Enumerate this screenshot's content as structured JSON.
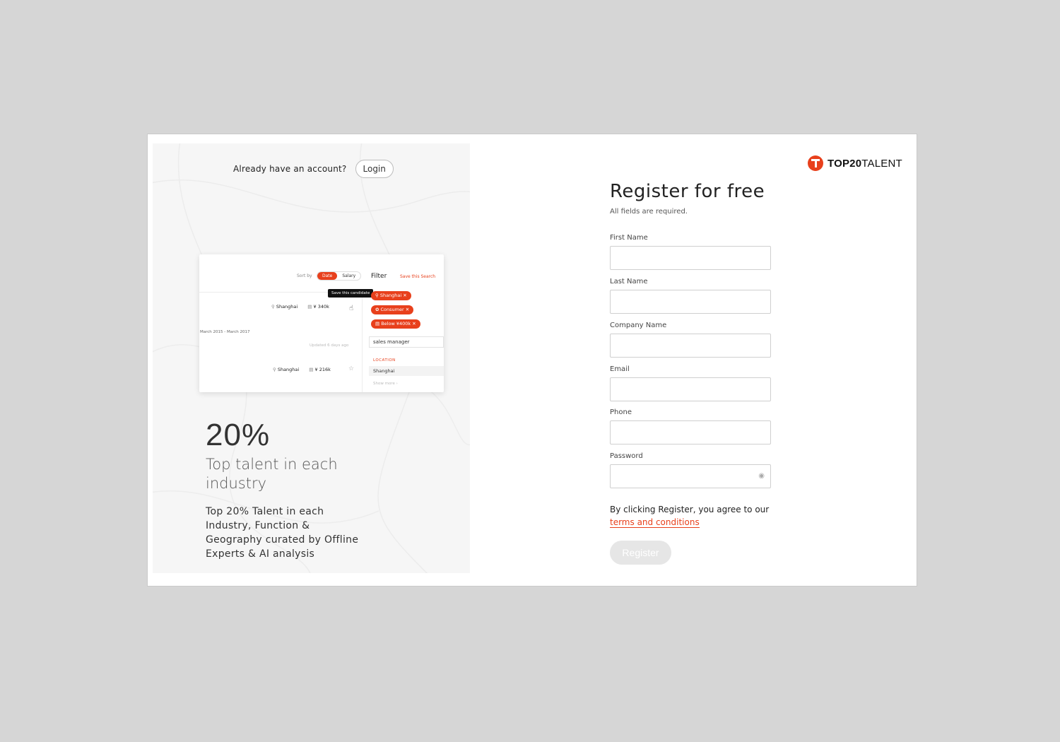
{
  "login_panel": {
    "already_text": "Already have an account?",
    "login_label": "Login"
  },
  "mockup": {
    "sort_by": "Sort by",
    "sort_options": [
      "Date",
      "Salary"
    ],
    "filter_title": "Filter",
    "save_search": "Save this Search",
    "tooltip": "Save this candidate",
    "chips": [
      "Shanghai",
      "Consumer",
      "Below ¥400k"
    ],
    "row1": {
      "location": "Shanghai",
      "salary": "¥ 340k"
    },
    "dates": "March 2015 - March 2017",
    "updated": "Updated 6 days ago",
    "row2": {
      "location": "Shanghai",
      "salary": "¥ 216k"
    },
    "keyword": "sales manager",
    "location_title": "LOCATION",
    "location_item": "Shanghai",
    "show_more": "Show more"
  },
  "promo": {
    "percent": "20%",
    "headline": "Top talent in each industry",
    "description": "Top 20% Talent in each Industry, Function & Geography curated by Offline Experts & AI analysis"
  },
  "logo": {
    "bold": "TOP20",
    "light": "TALENT"
  },
  "form": {
    "title": "Register for free",
    "required_note": "All fields are required.",
    "first_name_label": "First Name",
    "last_name_label": "Last Name",
    "company_label": "Company Name",
    "email_label": "Email",
    "phone_label": "Phone",
    "password_label": "Password",
    "agree_text": "By clicking Register, you agree to our",
    "terms_link": "terms and conditions",
    "register_label": "Register"
  },
  "colors": {
    "accent": "#e8401c",
    "background": "#d6d6d6"
  }
}
